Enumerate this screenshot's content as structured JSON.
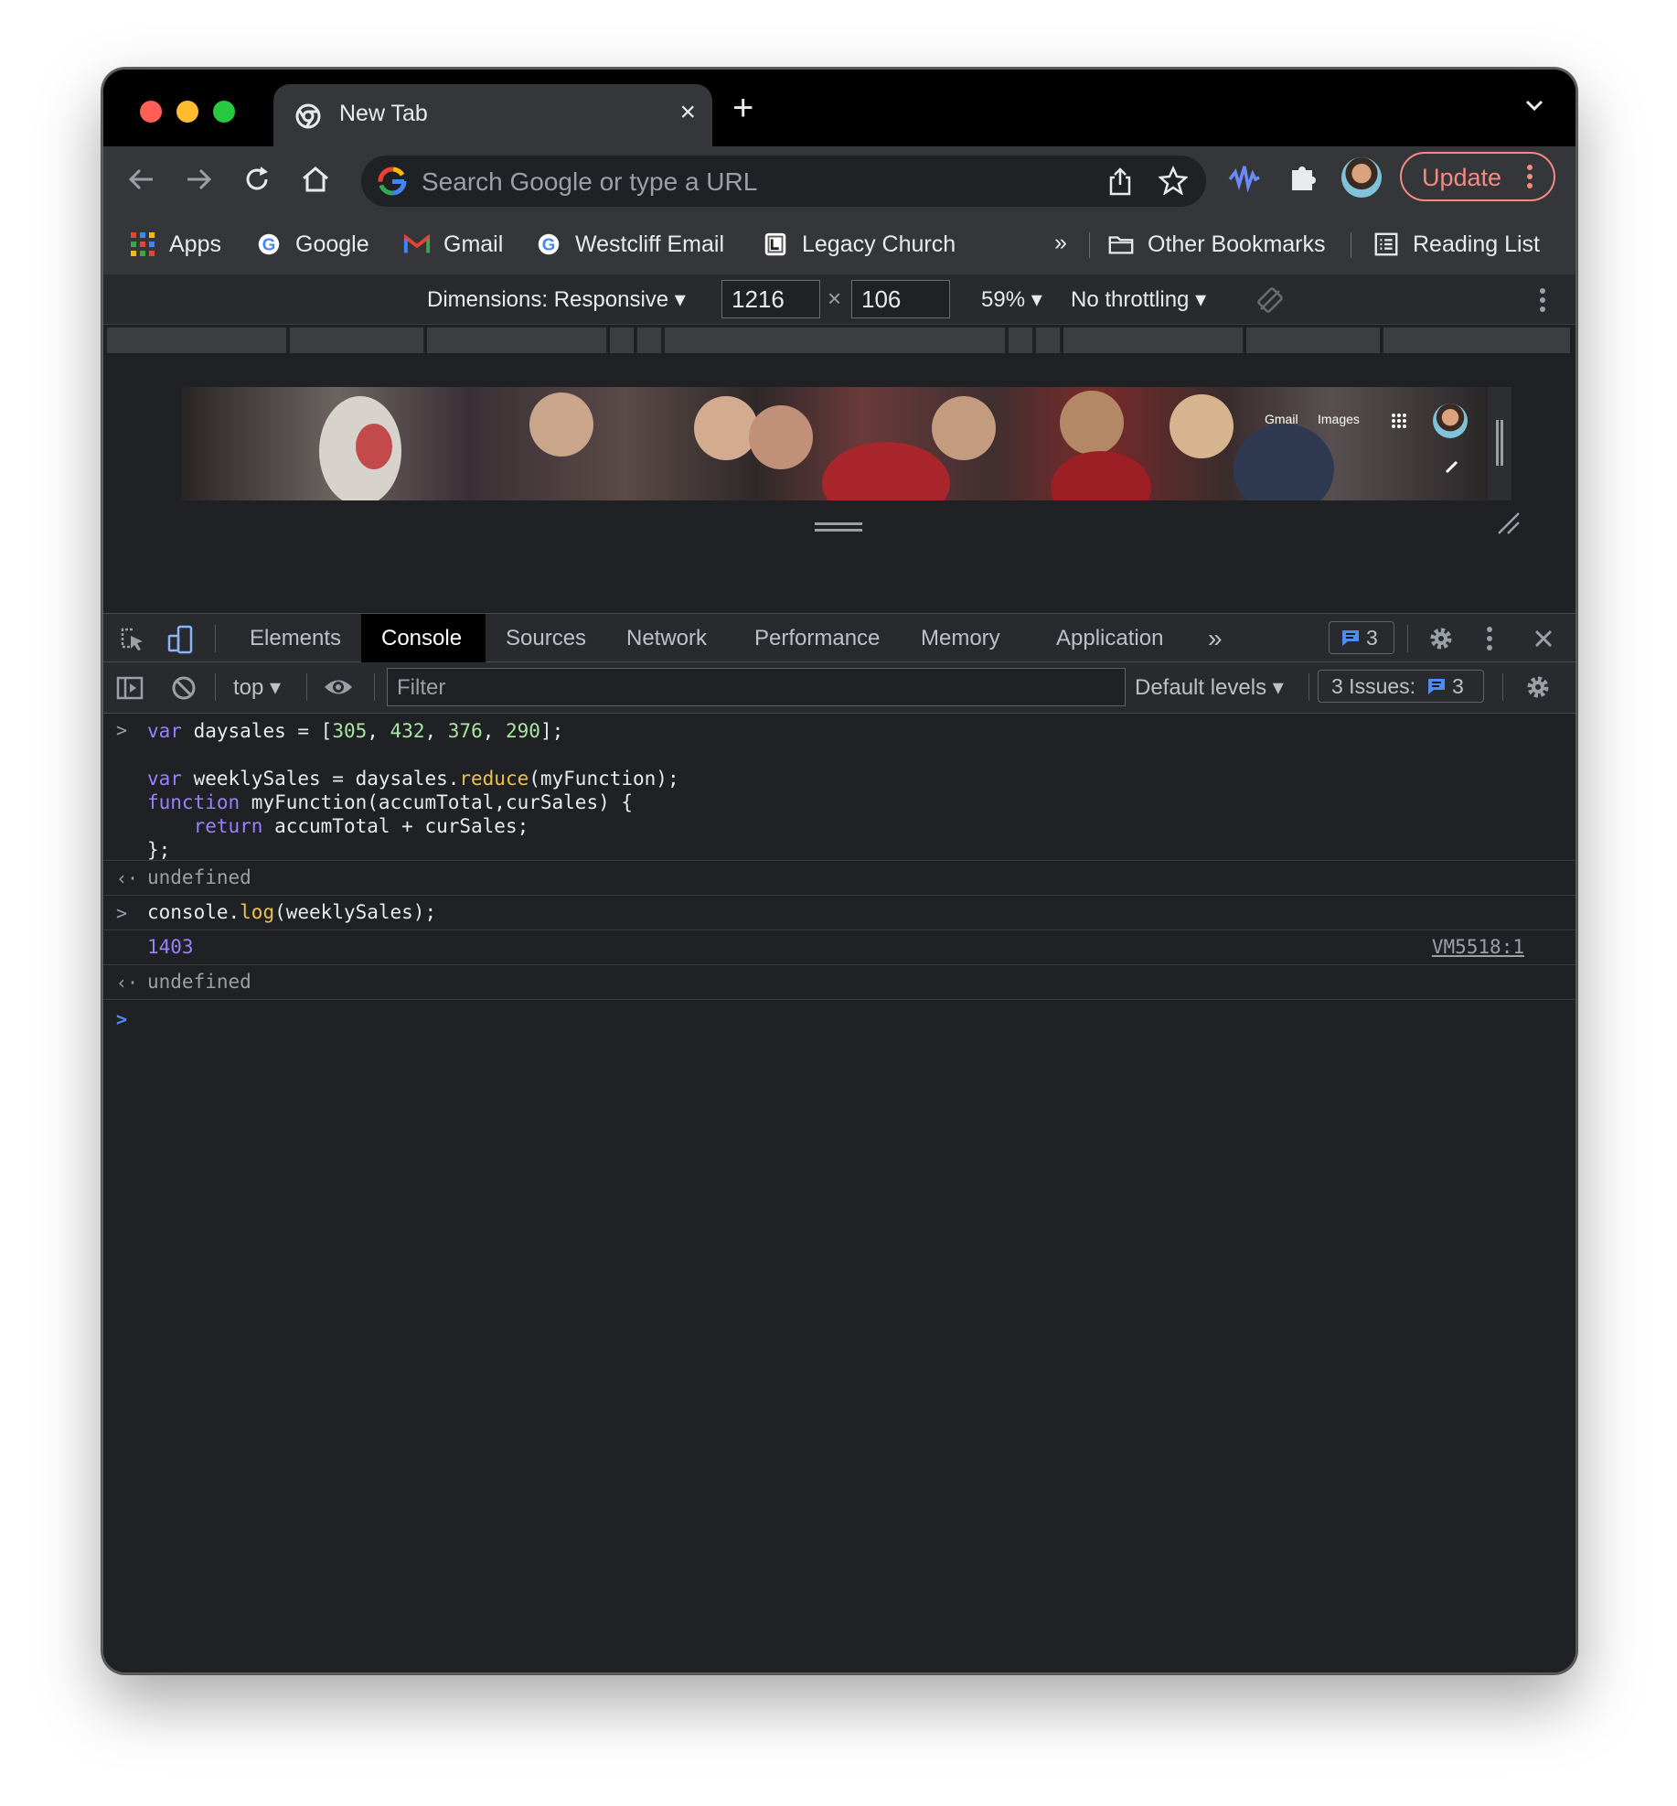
{
  "browser": {
    "tab_title": "New Tab",
    "tab_close": "×",
    "new_tab": "+",
    "omnibox_placeholder": "Search Google or type a URL",
    "update_label": "Update"
  },
  "bookmarks": {
    "items": [
      {
        "label": "Apps",
        "icon": "apps-grid-icon"
      },
      {
        "label": "Google",
        "icon": "google-icon"
      },
      {
        "label": "Gmail",
        "icon": "gmail-icon"
      },
      {
        "label": "Westcliff Email",
        "icon": "google-icon"
      },
      {
        "label": "Legacy Church",
        "icon": "legacy-icon"
      }
    ],
    "overflow": "»",
    "other": "Other Bookmarks",
    "reading_list": "Reading List"
  },
  "device_toolbar": {
    "dimensions_label": "Dimensions: Responsive",
    "width": "1216",
    "times": "×",
    "height": "106",
    "zoom": "59%",
    "throttling": "No throttling"
  },
  "page_preview": {
    "links": [
      "Gmail",
      "Images"
    ]
  },
  "devtools": {
    "tabs": [
      "Elements",
      "Console",
      "Sources",
      "Network",
      "Performance",
      "Memory",
      "Application"
    ],
    "active_tab": "Console",
    "more_tabs": "»",
    "message_count": "3"
  },
  "console_toolbar": {
    "context": "top",
    "filter_placeholder": "Filter",
    "levels": "Default levels",
    "issues_label": "3 Issues:",
    "issues_count": "3"
  },
  "console": {
    "input1": {
      "line1": {
        "kw": "var",
        "a": " daysales = [",
        "n1": "305",
        "n2": "432",
        "n3": "376",
        "n4": "290",
        "end": "];"
      },
      "line3": {
        "kw": "var",
        "a": " weeklySales = daysales.",
        "fn": "reduce",
        "b": "(myFunction);"
      },
      "line4": {
        "kw": "function",
        "a": " myFunction(accumTotal,curSales) {"
      },
      "line5": {
        "kw": "return",
        "a": " accumTotal + curSales;"
      },
      "line6": "};"
    },
    "result1": "undefined",
    "input2": {
      "a": "console.",
      "fn": "log",
      "b": "(weeklySales);"
    },
    "output2": "1403",
    "output2_source": "VM5518:1",
    "result2": "undefined"
  },
  "colors": {
    "keyword": "#9980ff",
    "number": "#a8e6a1",
    "function": "#ecc14b",
    "update_accent": "#f28b82"
  }
}
